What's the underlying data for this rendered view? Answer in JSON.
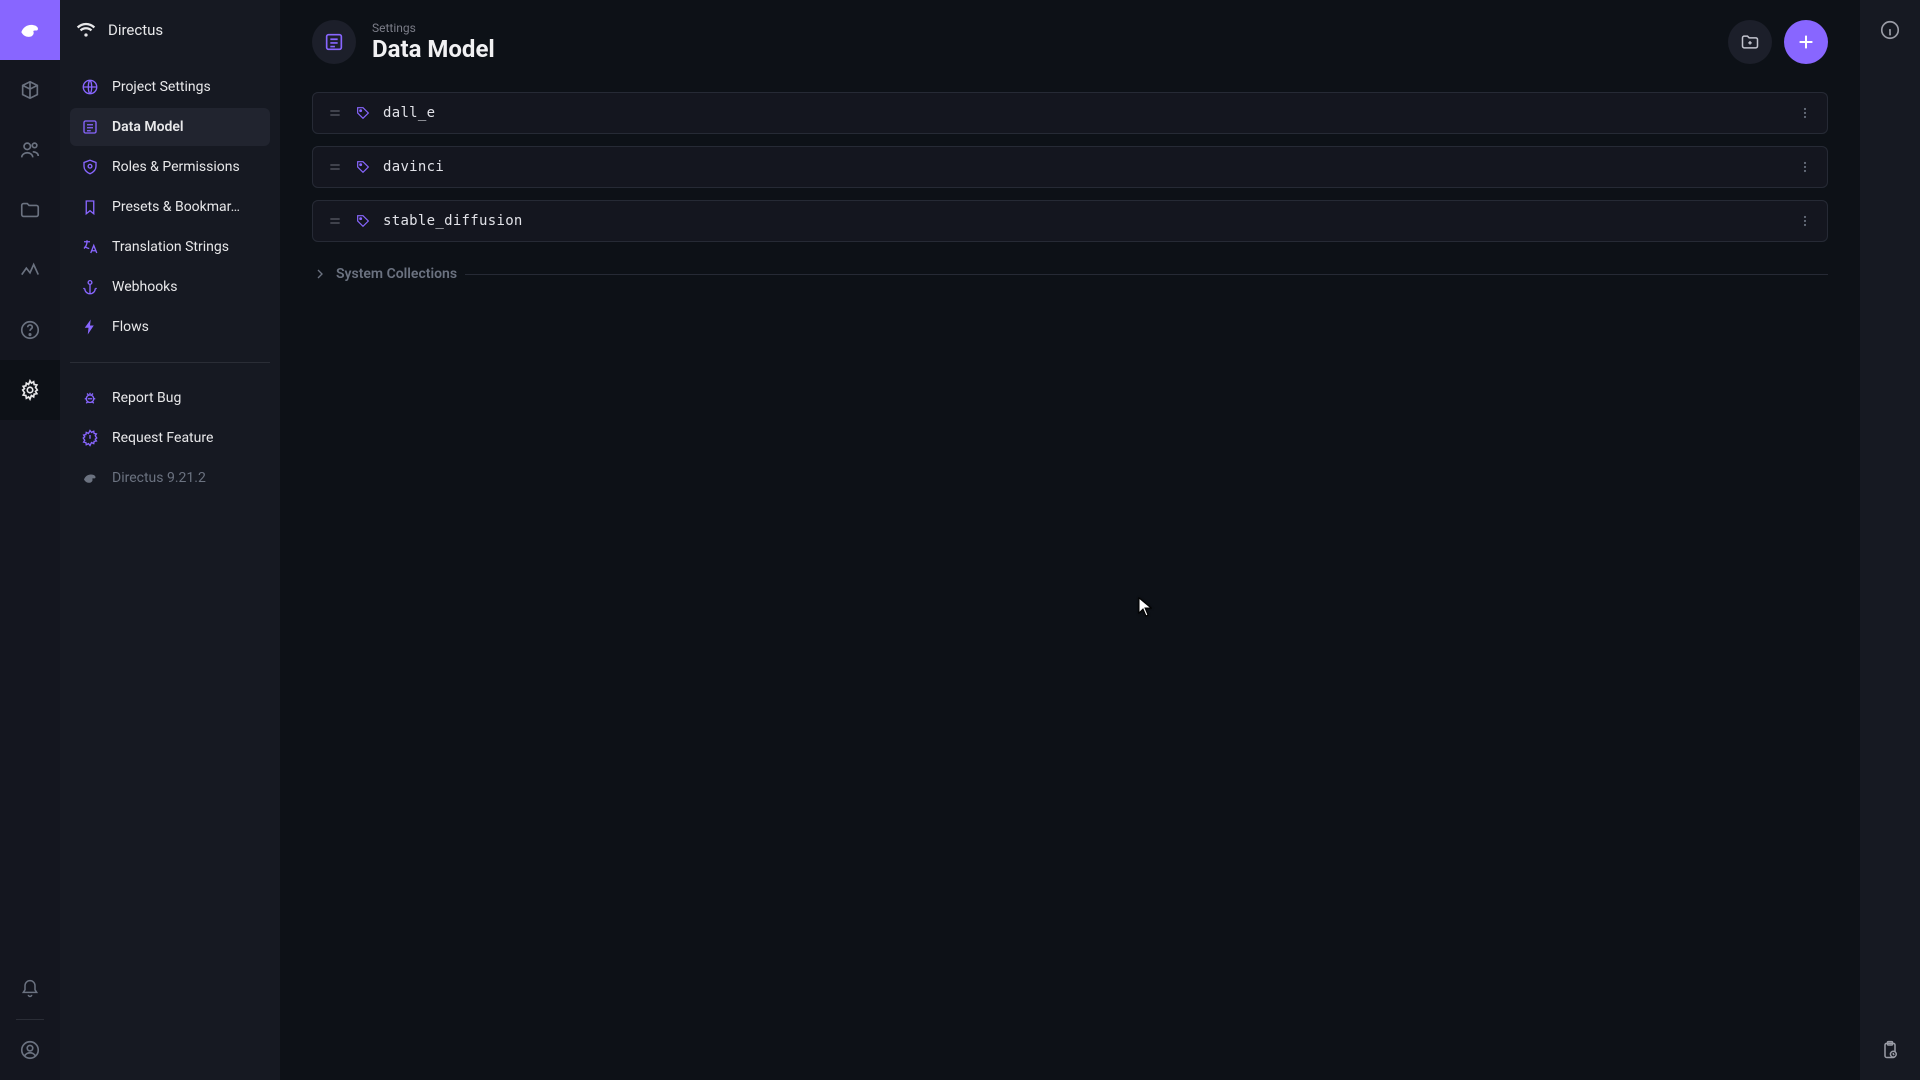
{
  "brand": {
    "name": "Directus"
  },
  "version": "Directus 9.21.2",
  "rail": [
    {
      "name": "content",
      "active": false
    },
    {
      "name": "users",
      "active": false
    },
    {
      "name": "files",
      "active": false
    },
    {
      "name": "insights",
      "active": false
    },
    {
      "name": "docs",
      "active": false
    },
    {
      "name": "settings",
      "active": true
    }
  ],
  "sidebar": {
    "items": [
      {
        "label": "Project Settings",
        "icon": "globe",
        "active": false
      },
      {
        "label": "Data Model",
        "icon": "list-box",
        "active": true
      },
      {
        "label": "Roles & Permissions",
        "icon": "shield",
        "active": false
      },
      {
        "label": "Presets & Bookmar…",
        "icon": "bookmark",
        "active": false
      },
      {
        "label": "Translation Strings",
        "icon": "translate",
        "active": false
      },
      {
        "label": "Webhooks",
        "icon": "anchor",
        "active": false
      },
      {
        "label": "Flows",
        "icon": "bolt",
        "active": false
      }
    ],
    "secondary": [
      {
        "label": "Report Bug",
        "icon": "bug"
      },
      {
        "label": "Request Feature",
        "icon": "new-releases"
      }
    ]
  },
  "page": {
    "breadcrumb": "Settings",
    "title": "Data Model"
  },
  "collections": [
    {
      "name": "dall_e"
    },
    {
      "name": "davinci"
    },
    {
      "name": "stable_diffusion"
    }
  ],
  "section": {
    "system_collections": "System Collections"
  },
  "colors": {
    "accent": "#8866ff"
  }
}
